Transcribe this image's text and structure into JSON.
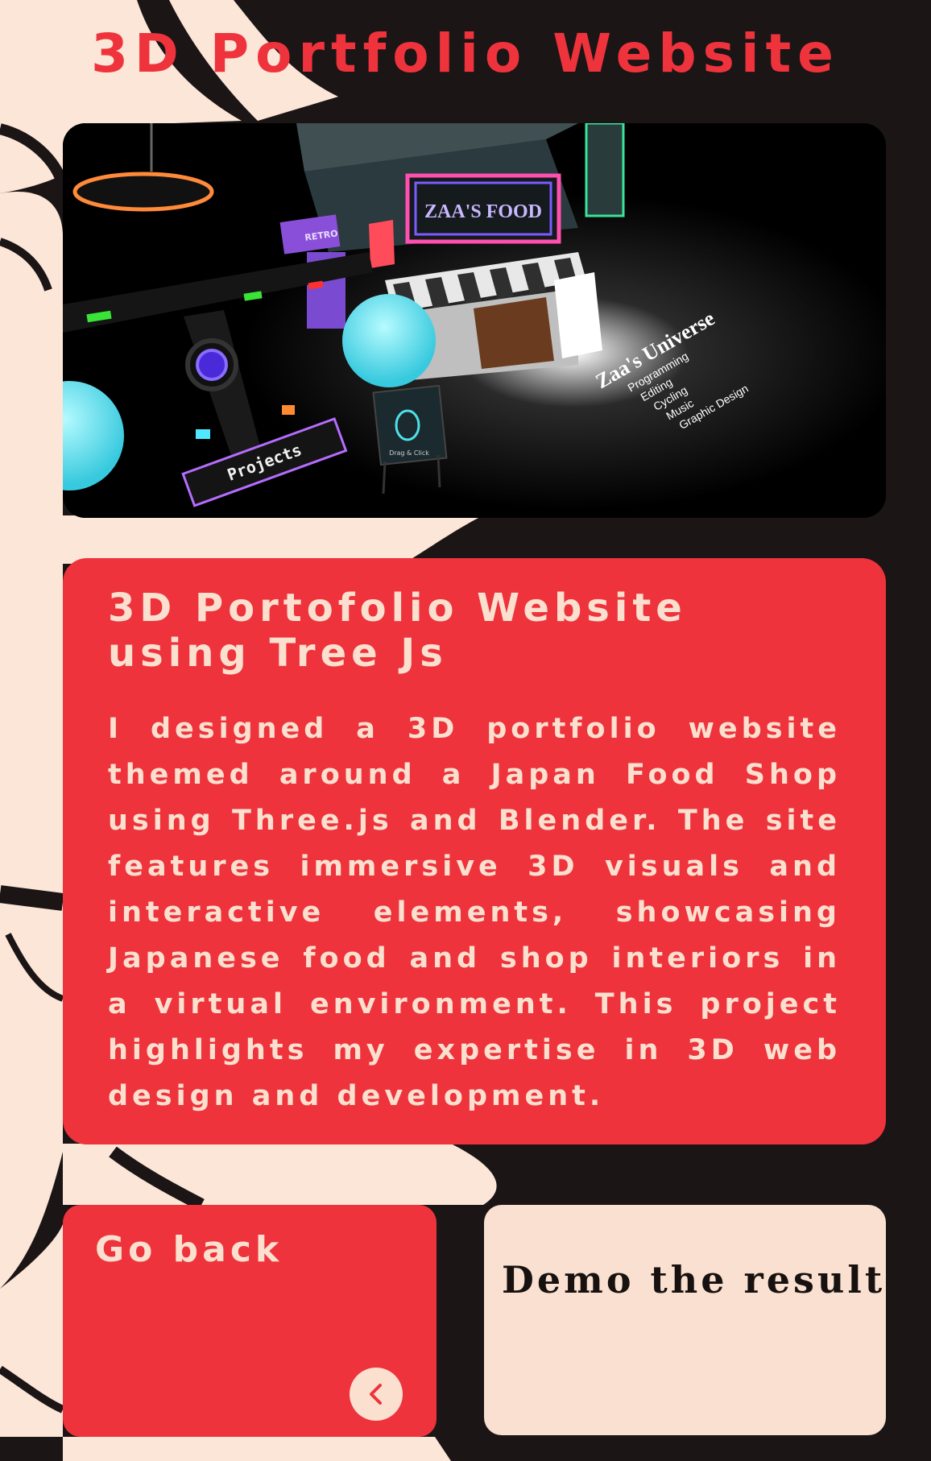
{
  "page": {
    "title": "3D Portfolio Website"
  },
  "hero": {
    "image_alt": "3D Japanese food shop scene",
    "sign_text": "ZAA'S FOOD",
    "retro_sign": "RETRO",
    "projects_sign": "Projects",
    "drag_sign": "Drag & Click",
    "universe_title": "Zaa's Universe",
    "universe_items": [
      "Programming",
      "Editing",
      "Cycling",
      "Music",
      "Graphic Design"
    ]
  },
  "description": {
    "heading": "3D Portofolio Website using Tree Js",
    "body": "I designed a 3D portfolio website themed around a Japan Food Shop using Three.js and Blender. The site features immersive 3D visuals and interactive elements, showcasing Japanese food and shop interiors in a virtual environment. This project highlights my expertise in 3D web design and development."
  },
  "actions": {
    "back_label": "Go back",
    "back_icon": "chevron-left-icon",
    "demo_label": "Demo the result"
  },
  "colors": {
    "accent": "#ee333c",
    "cream": "#f9e0d0",
    "dark": "#1c1516"
  }
}
